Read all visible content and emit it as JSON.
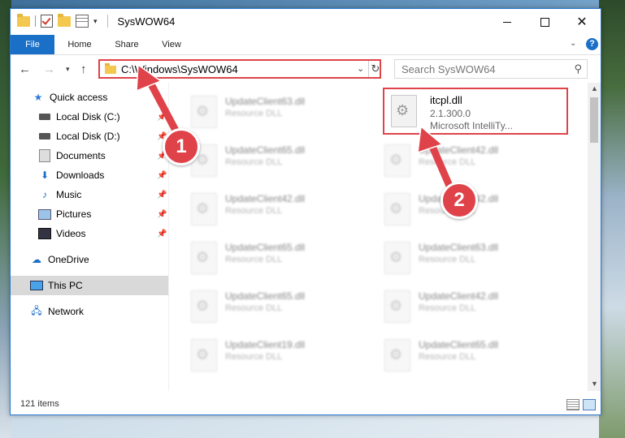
{
  "window": {
    "title": "SysWOW64"
  },
  "ribbon": {
    "file": "File",
    "home": "Home",
    "share": "Share",
    "view": "View"
  },
  "address": {
    "path": "C:\\Windows\\SysWOW64"
  },
  "search": {
    "placeholder": "Search SysWOW64"
  },
  "sidebar": {
    "items": [
      {
        "label": "Quick access",
        "icon": "star-icon"
      },
      {
        "label": "Local Disk (C:)",
        "icon": "drive-icon"
      },
      {
        "label": "Local Disk (D:)",
        "icon": "drive-icon"
      },
      {
        "label": "Documents",
        "icon": "documents-icon"
      },
      {
        "label": "Downloads",
        "icon": "downloads-icon"
      },
      {
        "label": "Music",
        "icon": "music-icon"
      },
      {
        "label": "Pictures",
        "icon": "pictures-icon"
      },
      {
        "label": "Videos",
        "icon": "videos-icon"
      },
      {
        "label": "OneDrive",
        "icon": "cloud-icon"
      },
      {
        "label": "This PC",
        "icon": "computer-icon"
      },
      {
        "label": "Network",
        "icon": "network-icon"
      }
    ]
  },
  "files": {
    "highlighted": {
      "name": "itcpl.dll",
      "version": "2.1.300.0",
      "description": "Microsoft IntelliTy..."
    },
    "left_column": [
      {
        "name": "UpdateClient63.dll",
        "type": "Resource DLL"
      },
      {
        "name": "UpdateClient65.dll",
        "type": "Resource DLL"
      },
      {
        "name": "UpdateClient42.dll",
        "type": "Resource DLL"
      },
      {
        "name": "UpdateClient65.dll",
        "type": "Resource DLL"
      },
      {
        "name": "UpdateClient65.dll",
        "type": "Resource DLL"
      },
      {
        "name": "UpdateClient19.dll",
        "type": "Resource DLL"
      }
    ],
    "right_column": [
      {
        "name": "UpdateClient42.dll",
        "type": "Resource DLL"
      },
      {
        "name": "UpdateClient42.dll",
        "type": "Resource DLL"
      },
      {
        "name": "UpdateClient63.dll",
        "type": "Resource DLL"
      },
      {
        "name": "UpdateClient42.dll",
        "type": "Resource DLL"
      },
      {
        "name": "UpdateClient65.dll",
        "type": "Resource DLL"
      }
    ]
  },
  "status": {
    "count": "121 items"
  },
  "annotations": {
    "step1": "1",
    "step2": "2",
    "color": "#e0424a"
  }
}
